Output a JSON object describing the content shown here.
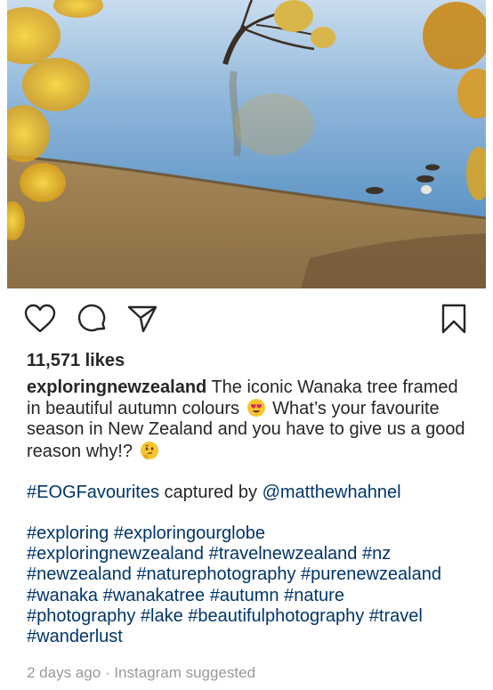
{
  "post": {
    "likes": "11,571 likes",
    "username": "exploringnewzealand",
    "caption_1": " The iconic Wanaka tree framed in beautiful autumn colours ",
    "caption_2": " What’s your favourite season in New Zealand and you have to give us a good reason why!? ",
    "tag_favourites": "#EOGFavourites",
    "captured_by": " captured by ",
    "mention": "@matthewhahnel",
    "hashtags": [
      "#exploring",
      "#exploringourglobe",
      "#exploringnewzealand",
      "#travelnewzealand",
      "#nz",
      "#newzealand",
      "#naturephotography",
      "#purenewzealand",
      "#wanaka",
      "#wanakatree",
      "#autumn",
      "#nature",
      "#photography",
      "#lake",
      "#beautifulphotography",
      "#travel",
      "#wanderlust"
    ],
    "timestamp": "2 days ago",
    "separator": " · ",
    "source": "Instagram suggested"
  },
  "icons": {
    "like": "heart-icon",
    "comment": "comment-bubble-icon",
    "share": "paper-plane-icon",
    "save": "bookmark-icon"
  },
  "colors": {
    "link": "#003569",
    "text": "#262626",
    "meta": "#999999"
  }
}
